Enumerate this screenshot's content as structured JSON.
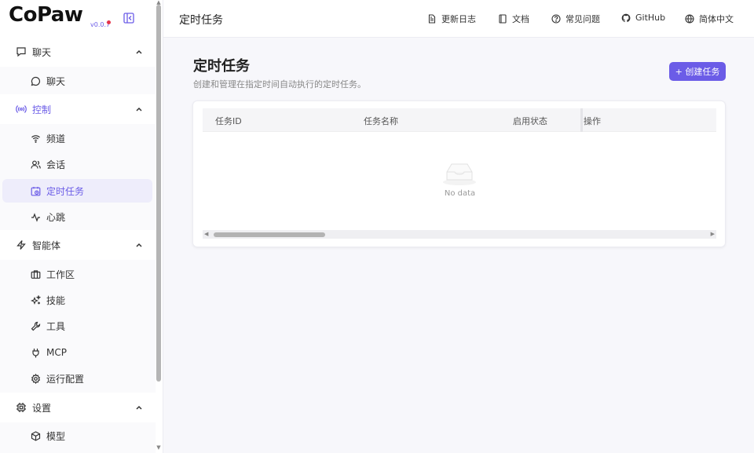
{
  "app": {
    "name": "CoPaw",
    "version": "v0.0.7"
  },
  "sidebar": {
    "groups": [
      {
        "label": "聊天",
        "icon": "chat-icon",
        "items": [
          {
            "label": "聊天",
            "icon": "message-circle-icon"
          }
        ]
      },
      {
        "label": "控制",
        "icon": "broadcast-icon",
        "active": true,
        "items": [
          {
            "label": "频道",
            "icon": "wifi-icon"
          },
          {
            "label": "会话",
            "icon": "users-icon"
          },
          {
            "label": "定时任务",
            "icon": "calendar-clock-icon",
            "active": true
          },
          {
            "label": "心跳",
            "icon": "activity-icon"
          }
        ]
      },
      {
        "label": "智能体",
        "icon": "zap-icon",
        "items": [
          {
            "label": "工作区",
            "icon": "briefcase-icon"
          },
          {
            "label": "技能",
            "icon": "sparkles-icon"
          },
          {
            "label": "工具",
            "icon": "wrench-icon"
          },
          {
            "label": "MCP",
            "icon": "plug-icon"
          },
          {
            "label": "运行配置",
            "icon": "gear-icon"
          }
        ]
      },
      {
        "label": "设置",
        "icon": "cpu-icon",
        "items": [
          {
            "label": "模型",
            "icon": "box-icon"
          }
        ]
      }
    ]
  },
  "header": {
    "title": "定时任务",
    "links": [
      {
        "label": "更新日志",
        "icon": "file-text-icon"
      },
      {
        "label": "文档",
        "icon": "book-icon"
      },
      {
        "label": "常见问题",
        "icon": "help-circle-icon"
      },
      {
        "label": "GitHub",
        "icon": "github-icon"
      },
      {
        "label": "简体中文",
        "icon": "globe-icon"
      }
    ]
  },
  "main": {
    "title": "定时任务",
    "description": "创建和管理在指定时间自动执行的定时任务。",
    "create_button": "+ 创建任务",
    "table": {
      "columns": [
        "任务ID",
        "任务名称",
        "启用状态",
        "操作"
      ],
      "rows": [],
      "empty_text": "No data"
    }
  },
  "colors": {
    "accent": "#6b5ce7",
    "active_bg": "#eeedfb"
  }
}
